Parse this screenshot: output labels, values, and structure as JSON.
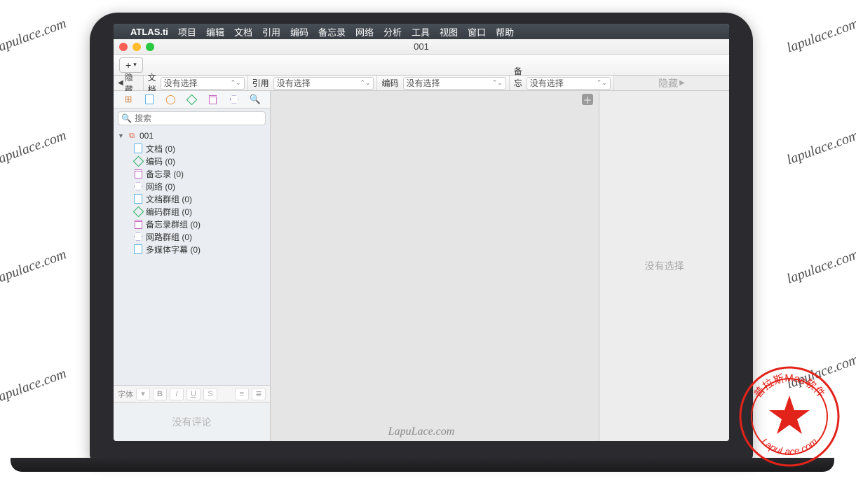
{
  "watermark": "lapulace.com",
  "footer_watermark": "LapuLace.com",
  "stamp_top": "普拉斯Mac软件",
  "stamp_bottom": "LapuLace.com",
  "menubar": {
    "app": "ATLAS.ti",
    "items": [
      "项目",
      "编辑",
      "文档",
      "引用",
      "编码",
      "备忘录",
      "网络",
      "分析",
      "工具",
      "视图",
      "窗口",
      "帮助"
    ]
  },
  "window": {
    "title": "001"
  },
  "toolbar": {
    "add": "+"
  },
  "headerbar": {
    "hide": "隐藏",
    "no_selection": "没有选择",
    "cols": [
      {
        "label": "文档"
      },
      {
        "label": "引用"
      },
      {
        "label": "编码"
      },
      {
        "label": "备忘录"
      }
    ]
  },
  "sidebar": {
    "search_placeholder": "搜索",
    "root": "001",
    "items": [
      {
        "label": "文档 (0)",
        "kind": "doc"
      },
      {
        "label": "编码 (0)",
        "kind": "diamond"
      },
      {
        "label": "备忘录 (0)",
        "kind": "memo"
      },
      {
        "label": "网络 (0)",
        "kind": "hex"
      },
      {
        "label": "文档群组 (0)",
        "kind": "doc"
      },
      {
        "label": "编码群组 (0)",
        "kind": "diamond"
      },
      {
        "label": "备忘录群组 (0)",
        "kind": "memo"
      },
      {
        "label": "网路群组 (0)",
        "kind": "hex"
      },
      {
        "label": "多媒体字幕 (0)",
        "kind": "doc"
      }
    ],
    "fontbar_label": "字体",
    "no_comment": "没有评论"
  },
  "right_panel": {
    "empty": "没有选择"
  }
}
